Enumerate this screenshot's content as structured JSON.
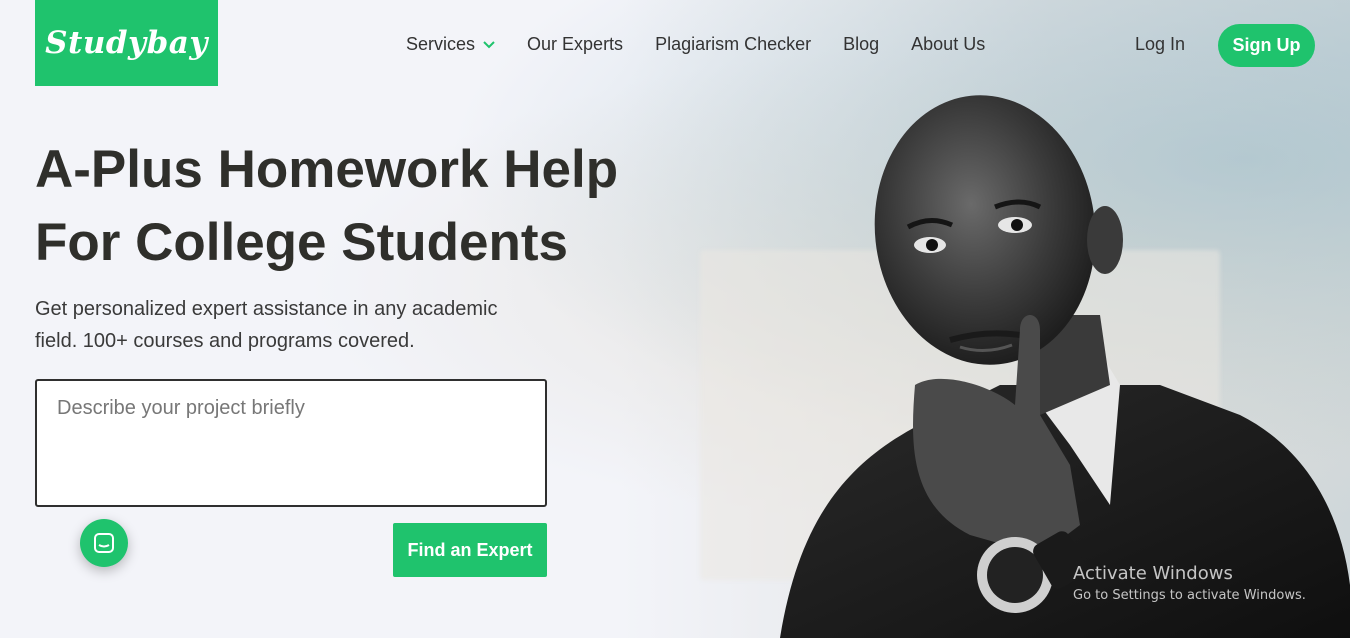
{
  "brand": {
    "name": "Studybay",
    "color": "#1fc36d"
  },
  "nav": {
    "items": [
      {
        "label": "Services",
        "has_dropdown": true
      },
      {
        "label": "Our Experts"
      },
      {
        "label": "Plagiarism Checker"
      },
      {
        "label": "Blog"
      },
      {
        "label": "About Us"
      }
    ],
    "login_label": "Log In",
    "signup_label": "Sign Up"
  },
  "hero": {
    "headline_line1": "A-Plus Homework Help",
    "headline_line2": "For College Students",
    "subtitle": "Get personalized expert assistance in any academic field. 100+ courses and programs covered.",
    "project_placeholder": "Describe your project briefly",
    "find_expert_label": "Find an Expert"
  },
  "chat": {
    "icon": "chat-icon"
  },
  "watermark": {
    "title": "Activate Windows",
    "subtitle": "Go to Settings to activate Windows."
  }
}
